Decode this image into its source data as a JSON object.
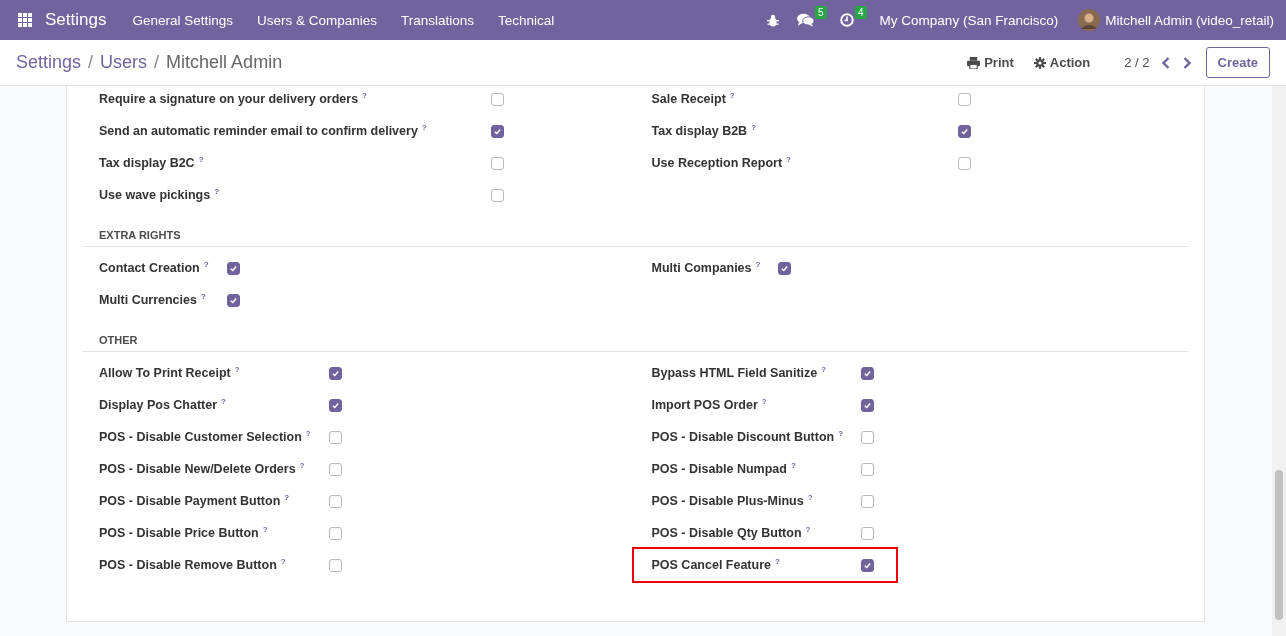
{
  "navbar": {
    "app_title": "Settings",
    "menus": [
      "General Settings",
      "Users & Companies",
      "Translations",
      "Technical"
    ],
    "messages_count": "5",
    "activities_count": "4",
    "company": "My Company (San Francisco)",
    "user": "Mitchell Admin (video_retail)"
  },
  "control_panel": {
    "breadcrumbs": [
      "Settings",
      "Users",
      "Mitchell Admin"
    ],
    "breadcrumb_separators": [
      "/",
      "/"
    ],
    "print": "Print",
    "action": "Action",
    "pager": "2 / 2",
    "create": "Create"
  },
  "sections": [
    {
      "left": [
        {
          "label": "Require a signature on your delivery orders",
          "help": "?",
          "checked": false,
          "highlighted": false
        },
        {
          "label": "Send an automatic reminder email to confirm delivery",
          "help": "?",
          "checked": true,
          "highlighted": false
        },
        {
          "label": "Tax display B2C",
          "help": "?",
          "checked": false,
          "highlighted": false
        },
        {
          "label": "Use wave pickings",
          "help": "?",
          "checked": false,
          "highlighted": false
        }
      ],
      "right": [
        {
          "label": "Sale Receipt",
          "help": "?",
          "checked": false,
          "highlighted": false
        },
        {
          "label": "Tax display B2B",
          "help": "?",
          "checked": true,
          "highlighted": false
        },
        {
          "label": "Use Reception Report",
          "help": "?",
          "checked": false,
          "highlighted": false
        }
      ]
    },
    {
      "heading": "EXTRA RIGHTS",
      "left": [
        {
          "label": "Contact Creation",
          "help": "?",
          "checked": true,
          "highlighted": false
        },
        {
          "label": "Multi Currencies",
          "help": "?",
          "checked": true,
          "highlighted": false
        }
      ],
      "right": [
        {
          "label": "Multi Companies",
          "help": "?",
          "checked": true,
          "highlighted": false
        }
      ]
    },
    {
      "heading": "OTHER",
      "left": [
        {
          "label": "Allow To Print Receipt",
          "help": "?",
          "checked": true,
          "highlighted": false
        },
        {
          "label": "Display Pos Chatter",
          "help": "?",
          "checked": true,
          "highlighted": false
        },
        {
          "label": "POS - Disable Customer Selection",
          "help": "?",
          "checked": false,
          "highlighted": false
        },
        {
          "label": "POS - Disable New/Delete Orders",
          "help": "?",
          "checked": false,
          "highlighted": false
        },
        {
          "label": "POS - Disable Payment Button",
          "help": "?",
          "checked": false,
          "highlighted": false
        },
        {
          "label": "POS - Disable Price Button",
          "help": "?",
          "checked": false,
          "highlighted": false
        },
        {
          "label": "POS - Disable Remove Button",
          "help": "?",
          "checked": false,
          "highlighted": false
        }
      ],
      "right": [
        {
          "label": "Bypass HTML Field Sanitize",
          "help": "?",
          "checked": true,
          "highlighted": false
        },
        {
          "label": "Import POS Order",
          "help": "?",
          "checked": true,
          "highlighted": false
        },
        {
          "label": "POS - Disable Discount Button",
          "help": "?",
          "checked": false,
          "highlighted": false
        },
        {
          "label": "POS - Disable Numpad",
          "help": "?",
          "checked": false,
          "highlighted": false
        },
        {
          "label": "POS - Disable Plus-Minus",
          "help": "?",
          "checked": false,
          "highlighted": false
        },
        {
          "label": "POS - Disable Qty Button",
          "help": "?",
          "checked": false,
          "highlighted": false
        },
        {
          "label": "POS Cancel Feature",
          "help": "?",
          "checked": true,
          "highlighted": true
        }
      ]
    }
  ]
}
